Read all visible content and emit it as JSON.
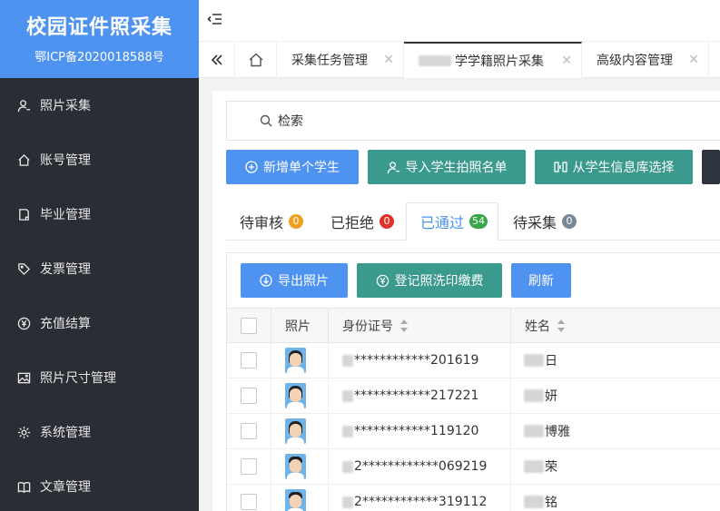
{
  "brand": {
    "title": "校园证件照采集",
    "icp": "鄂ICP备2020018588号"
  },
  "sidebar": {
    "items": [
      {
        "label": "照片采集",
        "icon": "user-icon"
      },
      {
        "label": "账号管理",
        "icon": "home-icon"
      },
      {
        "label": "毕业管理",
        "icon": "document-icon"
      },
      {
        "label": "发票管理",
        "icon": "tag-icon"
      },
      {
        "label": "充值结算",
        "icon": "yen-icon"
      },
      {
        "label": "照片尺寸管理",
        "icon": "image-icon"
      },
      {
        "label": "系统管理",
        "icon": "gear-icon"
      },
      {
        "label": "文章管理",
        "icon": "book-icon"
      }
    ]
  },
  "tabs": [
    {
      "label": "采集任务管理",
      "active": false
    },
    {
      "label": "学学籍照片采集",
      "active": true
    },
    {
      "label": "高级内容管理",
      "active": false
    }
  ],
  "search": {
    "label": "检索"
  },
  "actions": {
    "add_student": "新增单个学生",
    "import_list": "导入学生拍照名单",
    "select_from_db": "从学生信息库选择"
  },
  "status_tabs": [
    {
      "label": "待审核",
      "count": "0",
      "color": "#f0a020"
    },
    {
      "label": "已拒绝",
      "count": "0",
      "color": "#e0312b"
    },
    {
      "label": "已通过",
      "count": "54",
      "color": "#3aa64a"
    },
    {
      "label": "待采集",
      "count": "0",
      "color": "#7a8796"
    }
  ],
  "table_actions": {
    "export": "导出照片",
    "register_fee": "登记照洗印缴费",
    "refresh": "刷新"
  },
  "table": {
    "headers": {
      "photo": "照片",
      "id_number": "身份证号",
      "name": "姓名"
    },
    "rows": [
      {
        "id_suffix": "************201619",
        "name_tail": "日",
        "hair": "long"
      },
      {
        "id_suffix": "************217221",
        "name_tail": "妍",
        "hair": "long"
      },
      {
        "id_suffix": "************119120",
        "name_tail": "博雅",
        "hair": "long"
      },
      {
        "id_suffix": "2************069219",
        "name_tail": "荣",
        "hair": "short"
      },
      {
        "id_suffix": "2************319112",
        "name_tail": "铭",
        "hair": "short"
      }
    ]
  },
  "colors": {
    "sidebar_bg": "#2b2d35",
    "brand_bg": "#4f93f0",
    "primary": "#4f93f0",
    "teal": "#3a9a8d"
  }
}
